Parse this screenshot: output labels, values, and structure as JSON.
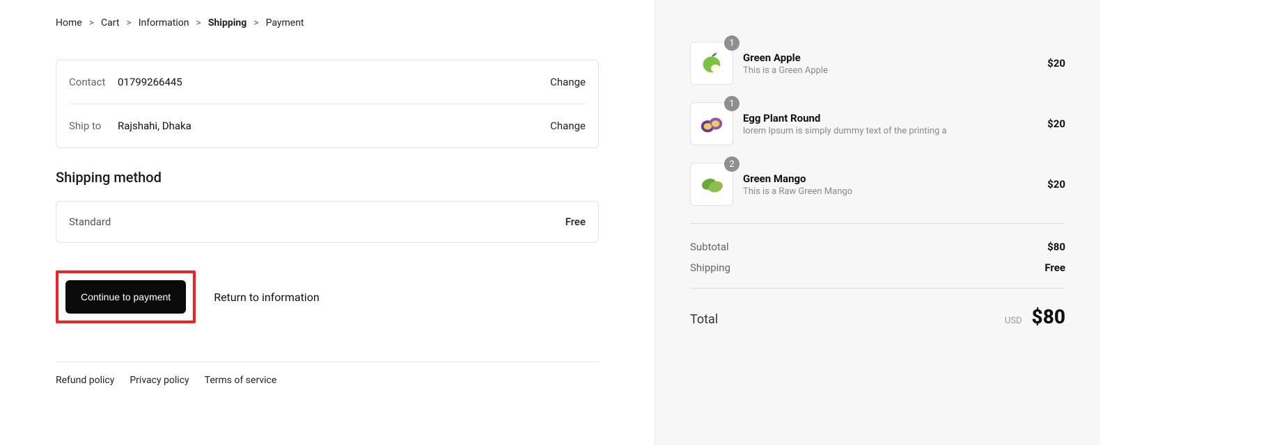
{
  "breadcrumb": {
    "home": "Home",
    "cart": "Cart",
    "information": "Information",
    "shipping": "Shipping",
    "payment": "Payment",
    "sep": ">"
  },
  "summary": {
    "contact_label": "Contact",
    "contact_value": "01799266445",
    "contact_change": "Change",
    "shipto_label": "Ship to",
    "shipto_value": "Rajshahi, Dhaka",
    "shipto_change": "Change"
  },
  "section_title": "Shipping method",
  "method": {
    "name": "Standard",
    "price": "Free"
  },
  "actions": {
    "continue": "Continue to payment",
    "return": "Return to information"
  },
  "footer": {
    "refund": "Refund policy",
    "privacy": "Privacy policy",
    "terms": "Terms of service"
  },
  "cart": {
    "items": [
      {
        "qty": "1",
        "name": "Green Apple",
        "desc": "This is a Green Apple",
        "price": "$20"
      },
      {
        "qty": "1",
        "name": "Egg Plant Round",
        "desc": "lorem Ipsum is simply dummy text of the printing a",
        "price": "$20"
      },
      {
        "qty": "2",
        "name": "Green Mango",
        "desc": "This is a Raw Green Mango",
        "price": "$20"
      }
    ]
  },
  "totals": {
    "subtotal_label": "Subtotal",
    "subtotal_value": "$80",
    "shipping_label": "Shipping",
    "shipping_value": "Free",
    "total_label": "Total",
    "currency": "USD",
    "total_value": "$80"
  }
}
